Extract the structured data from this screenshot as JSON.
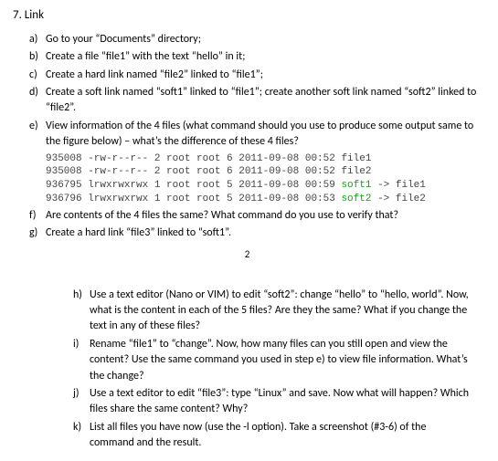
{
  "heading": "7. Link",
  "top_items": [
    {
      "label": "a)",
      "text": "Go to your “Documents” directory;"
    },
    {
      "label": "b)",
      "text": "Create a file “file1” with the text “hello” in it;"
    },
    {
      "label": "c)",
      "text": "Create a hard link named “file2” linked to “file1”;"
    },
    {
      "label": "d)",
      "text": "Create a soft link named “soft1” linked to “file1”; create another soft link named “soft2” linked to “file2”."
    },
    {
      "label": "e)",
      "text": "View information of the 4 files (what command should you use to produce some output same to the figure below) – what’s the difference of these 4 files?"
    }
  ],
  "code": {
    "line1_a": "935008 -rw-r--r-- 2 root root 6 2011-09-08 00:52 file1",
    "line2_a": "935008 -rw-r--r-- 2 root root 6 2011-09-08 00:52 file2",
    "line3_a": "936795 lrwxrwxrwx 1 root root 5 2011-09-08 00:59 ",
    "line3_soft": "soft1",
    "line3_b": " -> file1",
    "line4_a": "936796 lrwxrwxrwx 1 root root 5 2011-09-08 00:53 ",
    "line4_soft": "soft2",
    "line4_b": " -> file2"
  },
  "after_code_items": [
    {
      "label": "f)",
      "text": "Are contents of the 4 files the same? What command do you use to verify that?"
    },
    {
      "label": "g)",
      "text": "Create a hard link “file3” linked to “soft1”."
    }
  ],
  "page_number": "2",
  "bottom_items": [
    {
      "label": "h)",
      "text": "Use a text editor (Nano or VIM) to edit “soft2”: change “hello” to “hello, world”. Now, what is the content in each of the 5 files? Are they the same? What if you change the text in any of these files?"
    },
    {
      "label": "i)",
      "text": "Rename “file1” to “change”. Now, how many files can you still open and view the content? Use the same command you used in step e) to view file information. What’s the change?"
    },
    {
      "label": "j)",
      "text": "Use a text editor to edit “file3”: type “Linux” and save. Now what will happen? Which files share the same content? Why?"
    },
    {
      "label": "k)",
      "text": "List all files you have now (use the -l option). Take a screenshot (#3-6) of the command and the result."
    }
  ]
}
